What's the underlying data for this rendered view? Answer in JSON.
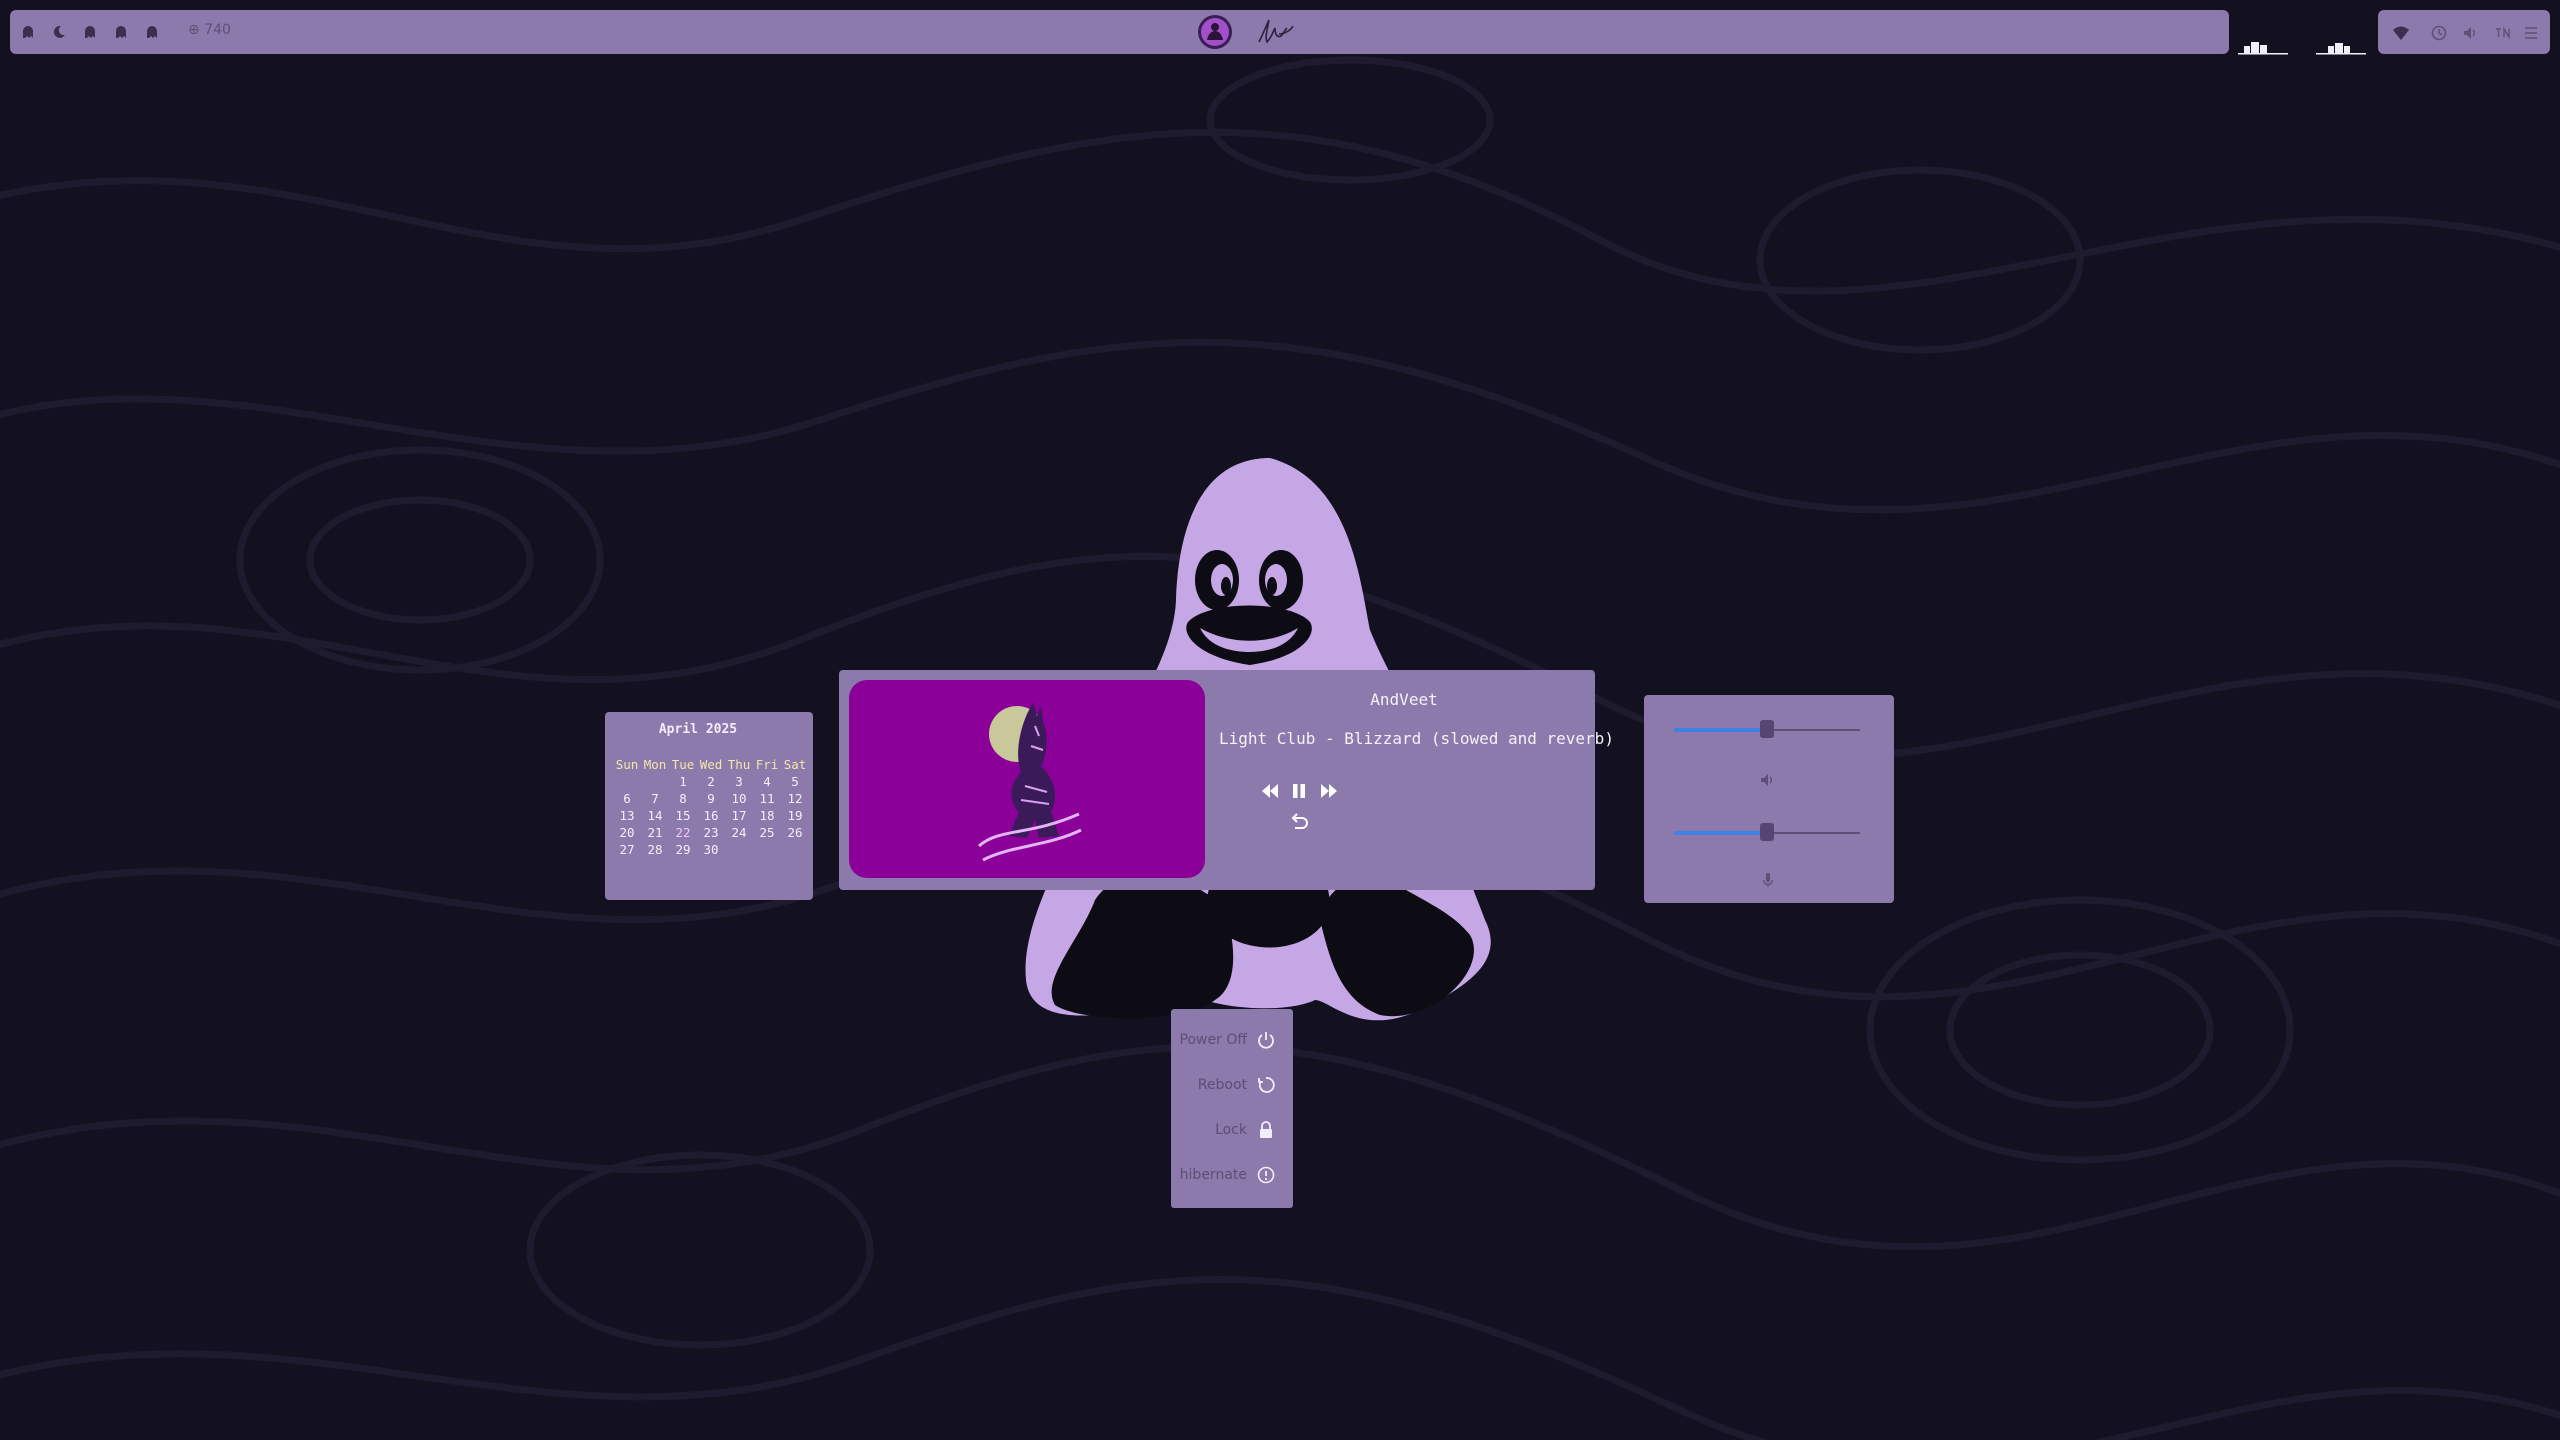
{
  "topbar": {
    "workspaces": [
      {
        "icon": "ghost-icon"
      },
      {
        "icon": "moon-icon"
      },
      {
        "icon": "ghost-icon"
      },
      {
        "icon": "ghost-icon"
      },
      {
        "icon": "ghost-icon"
      }
    ],
    "workspace_count": "740",
    "tray": [
      "wifi-icon",
      "clock-icon",
      "volume-icon",
      "keyboard-icon"
    ]
  },
  "calendar": {
    "title": "April 2025",
    "weekdays": [
      "Sun",
      "Mon",
      "Tue",
      "Wed",
      "Thu",
      "Fri",
      "Sat"
    ],
    "weeks": [
      [
        "",
        "",
        "1",
        "2",
        "3",
        "4",
        "5"
      ],
      [
        "6",
        "7",
        "8",
        "9",
        "10",
        "11",
        "12"
      ],
      [
        "13",
        "14",
        "15",
        "16",
        "17",
        "18",
        "19"
      ],
      [
        "20",
        "21",
        "22",
        "23",
        "24",
        "25",
        "26"
      ],
      [
        "27",
        "28",
        "29",
        "30",
        "",
        "",
        ""
      ]
    ],
    "today": "22"
  },
  "player": {
    "artist": "AndVeet",
    "title": "Light Club - Blizzard (slowed and reverb)",
    "controls": [
      "previous-icon",
      "pause-icon",
      "next-icon",
      "repeat-icon"
    ]
  },
  "sliders": {
    "volume_level": 0.5,
    "mic_level": 0.5
  },
  "power_menu": [
    {
      "label": "Power Off",
      "icon": "power-icon"
    },
    {
      "label": "Reboot",
      "icon": "reboot-icon"
    },
    {
      "label": "Lock",
      "icon": "lock-icon"
    },
    {
      "label": "hibernate",
      "icon": "info-icon"
    }
  ],
  "colors": {
    "panel": "#8b7aab",
    "background": "#131120",
    "accent": "#3d82e4",
    "cover": "#8a0099",
    "tux": "#c6a7e6"
  }
}
